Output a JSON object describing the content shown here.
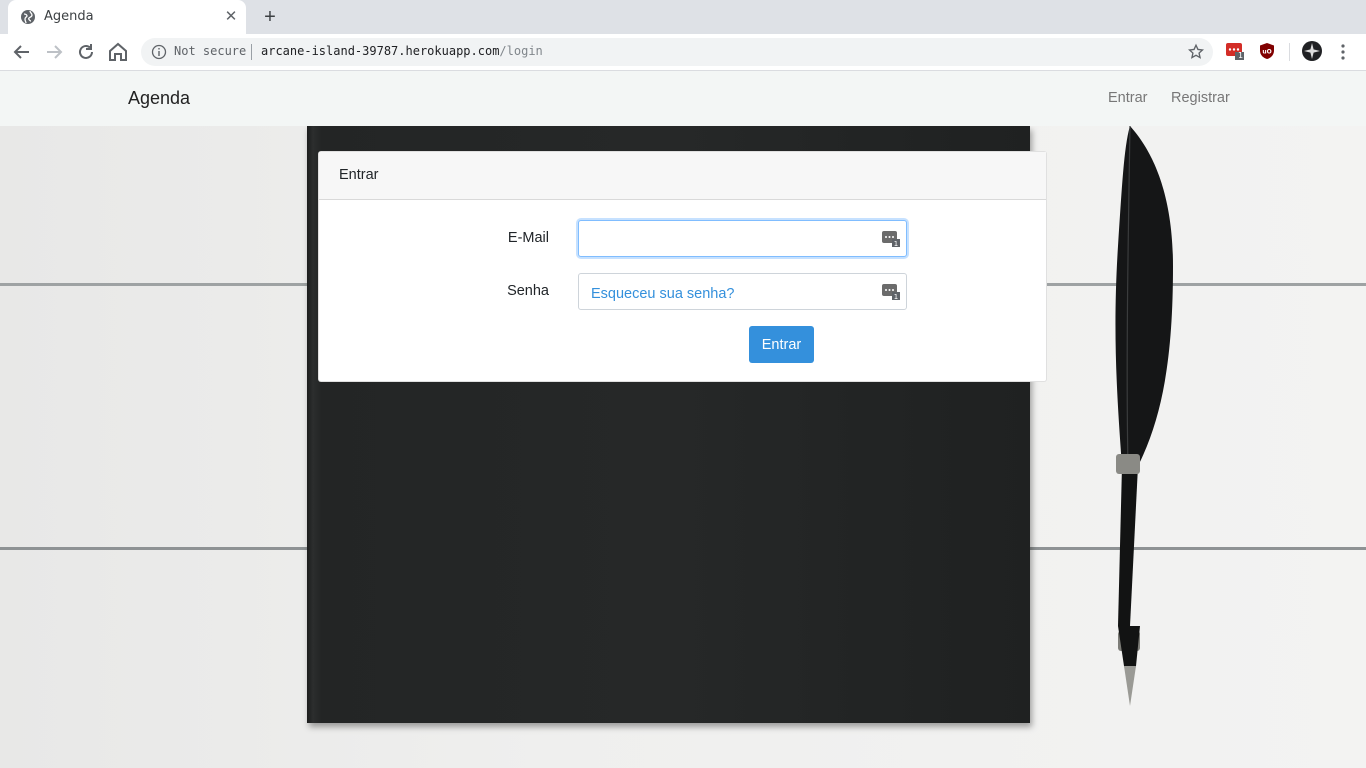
{
  "browser": {
    "tab_title": "Agenda",
    "security_label": "Not secure",
    "url_host": "arcane-island-39787.herokuapp.com",
    "url_path": "/login",
    "extension_badge": "1"
  },
  "navbar": {
    "brand": "Agenda",
    "links": [
      "Entrar",
      "Registrar"
    ]
  },
  "login_card": {
    "header": "Entrar",
    "email_label": "E-Mail",
    "email_value": "",
    "password_label": "Senha",
    "password_value": "",
    "forgot_link": "Esqueceu sua senha?",
    "submit_label": "Entrar",
    "field_icon_badge": "1"
  },
  "colors": {
    "primary": "#3490dc",
    "navbar_bg": "#f3f6f5",
    "focus_ring": "#80bdff"
  }
}
